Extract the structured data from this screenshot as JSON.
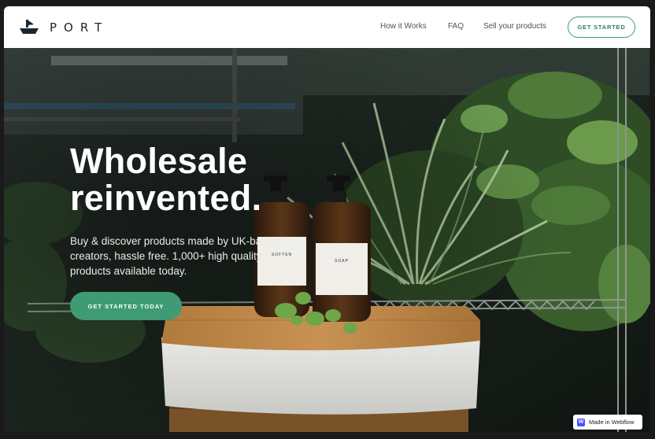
{
  "brand": {
    "name": "PORT"
  },
  "nav": {
    "links": [
      "How it Works",
      "FAQ",
      "Sell your products"
    ],
    "cta": "GET STARTED"
  },
  "hero": {
    "headline_line1": "Wholesale",
    "headline_line2": "reinvented.",
    "subtext_line1": "Buy & discover products made by UK-based",
    "subtext_line2": "creators, hassle free. 1,000+ high quality",
    "subtext_line3": "products available today.",
    "cta": "GET STARTED TODAY",
    "bottle_left_label": "SOFTEN",
    "bottle_right_label": "SOAP"
  },
  "badge": {
    "icon_letter": "W",
    "text": "Made in Webflow"
  },
  "colors": {
    "accent": "#3f9b74",
    "nav_text": "#4a525a",
    "logo": "#1c2630"
  }
}
